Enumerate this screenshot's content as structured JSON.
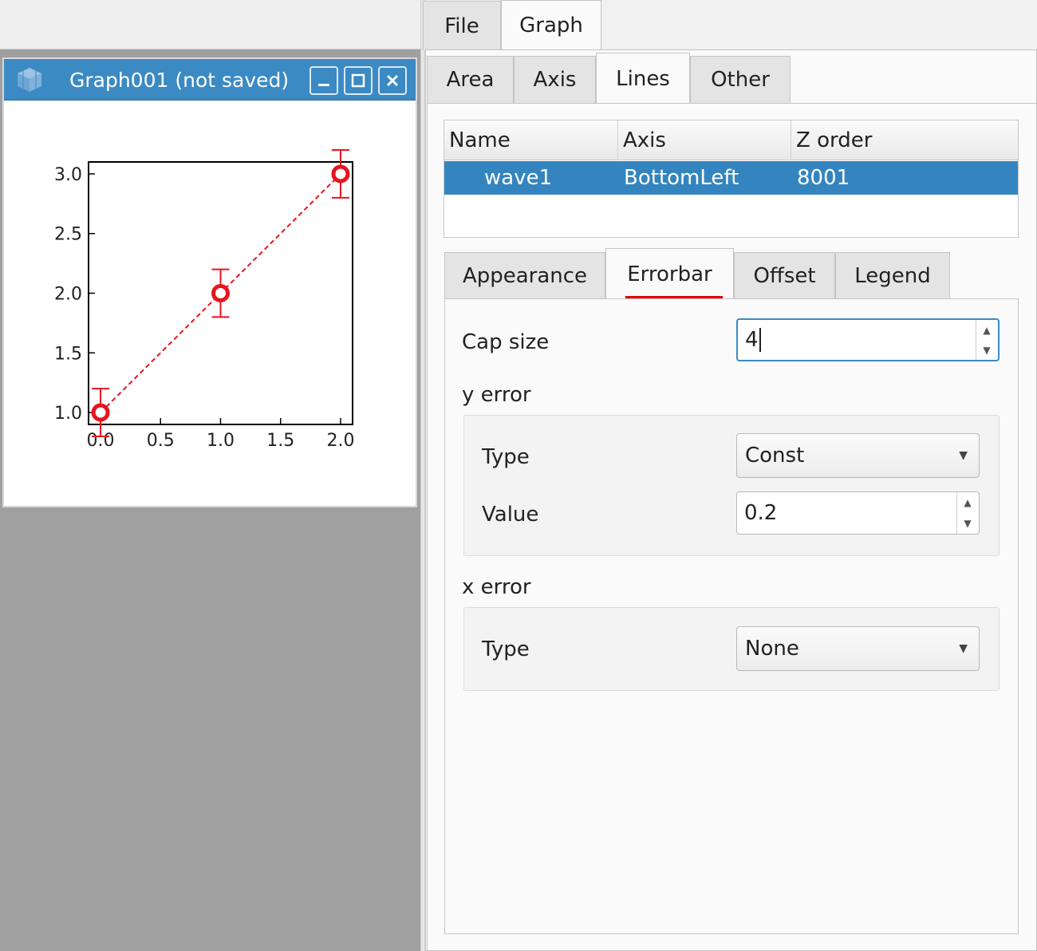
{
  "main_tabs": [
    {
      "label": "File",
      "active": false
    },
    {
      "label": "Graph",
      "active": true
    }
  ],
  "subwindow": {
    "title": "Graph001 (not saved)",
    "buttons": [
      "minimize",
      "maximize",
      "close"
    ]
  },
  "graph_tabs": [
    {
      "label": "Area",
      "active": false
    },
    {
      "label": "Axis",
      "active": false
    },
    {
      "label": "Lines",
      "active": true
    },
    {
      "label": "Other",
      "active": false
    }
  ],
  "lines_table": {
    "headers": [
      "Name",
      "Axis",
      "Z order"
    ],
    "rows": [
      {
        "name": "wave1",
        "axis": "BottomLeft",
        "zorder": "8001",
        "selected": true
      }
    ]
  },
  "line_tabs": [
    {
      "label": "Appearance",
      "active": false
    },
    {
      "label": "Errorbar",
      "active": true
    },
    {
      "label": "Offset",
      "active": false
    },
    {
      "label": "Legend",
      "active": false
    }
  ],
  "errorbar": {
    "cap_size_label": "Cap size",
    "cap_size_value": "4",
    "y_error": {
      "label": "y error",
      "type_label": "Type",
      "type_value": "Const",
      "value_label": "Value",
      "value_value": "0.2"
    },
    "x_error": {
      "label": "x error",
      "type_label": "Type",
      "type_value": "None"
    }
  },
  "colors": {
    "accent": "#3b8ac4",
    "selection": "#3485bf",
    "series": "#e8141e",
    "tab_indicator": "#e00000"
  },
  "chart_data": {
    "type": "scatter",
    "x": [
      0.0,
      1.0,
      2.0
    ],
    "y": [
      1.0,
      2.0,
      3.0
    ],
    "yerr": 0.2,
    "line_style": "dashed",
    "marker": "circle",
    "xlim": [
      -0.1,
      2.1
    ],
    "ylim": [
      0.9,
      3.1
    ],
    "xticks": [
      "0.0",
      "0.5",
      "1.0",
      "1.5",
      "2.0"
    ],
    "yticks": [
      "1.0",
      "1.5",
      "2.0",
      "2.5",
      "3.0"
    ],
    "grid": false
  }
}
